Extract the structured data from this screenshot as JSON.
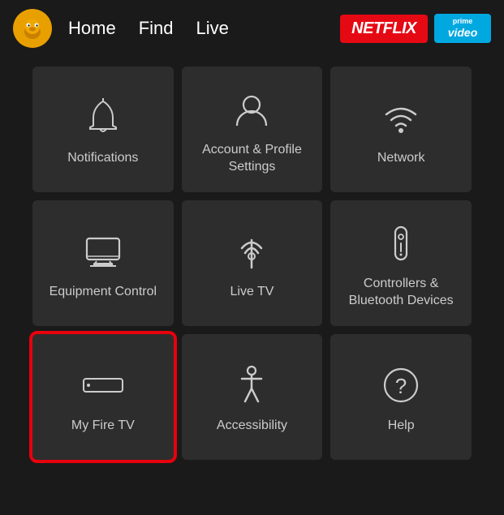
{
  "nav": {
    "home_label": "Home",
    "find_label": "Find",
    "live_label": "Live",
    "netflix_label": "NETFLIX",
    "prime_label_top": "prime",
    "prime_label_bottom": "video"
  },
  "grid": {
    "items": [
      {
        "id": "notifications",
        "label": "Notifications",
        "icon": "bell"
      },
      {
        "id": "account-profile",
        "label": "Account & Profile Settings",
        "icon": "person"
      },
      {
        "id": "network",
        "label": "Network",
        "icon": "wifi"
      },
      {
        "id": "equipment-control",
        "label": "Equipment Control",
        "icon": "tv"
      },
      {
        "id": "live-tv",
        "label": "Live TV",
        "icon": "antenna"
      },
      {
        "id": "controllers-bluetooth",
        "label": "Controllers & Bluetooth Devices",
        "icon": "remote"
      },
      {
        "id": "my-fire-tv",
        "label": "My Fire TV",
        "icon": "firetv",
        "selected": true
      },
      {
        "id": "accessibility",
        "label": "Accessibility",
        "icon": "accessibility"
      },
      {
        "id": "help",
        "label": "Help",
        "icon": "question"
      }
    ]
  }
}
